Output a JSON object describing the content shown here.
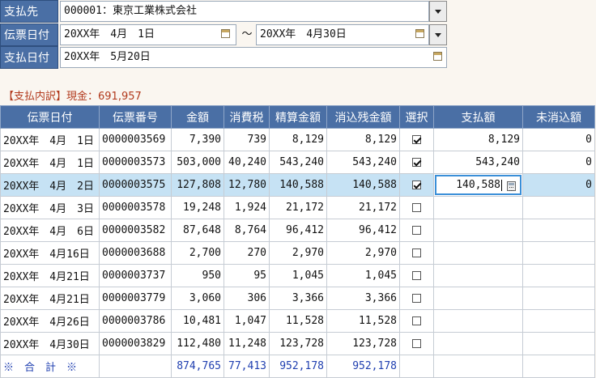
{
  "filters": {
    "payee": {
      "label": "支払先",
      "value": "000001：東京工業株式会社"
    },
    "voucher_date": {
      "label": "伝票日付",
      "from": "20XX年　4月　1日",
      "separator": "～",
      "to": "20XX年　4月30日"
    },
    "payment_date": {
      "label": "支払日付",
      "value": "20XX年　5月20日"
    }
  },
  "summary": "【支払内訳】現金：691,957",
  "table": {
    "headers": [
      "伝票日付",
      "伝票番号",
      "金額",
      "消費税",
      "精算金額",
      "消込残金額",
      "選択",
      "支払額",
      "未消込額"
    ],
    "rows": [
      {
        "date": "20XX年　4月　1日",
        "no": "0000003569",
        "amount": "7,390",
        "tax": "739",
        "settle": "8,129",
        "remain": "8,129",
        "checked": true,
        "pay": "8,129",
        "uncleared": "0"
      },
      {
        "date": "20XX年　4月　1日",
        "no": "0000003573",
        "amount": "503,000",
        "tax": "40,240",
        "settle": "543,240",
        "remain": "543,240",
        "checked": true,
        "pay": "543,240",
        "uncleared": "0"
      },
      {
        "date": "20XX年　4月　2日",
        "no": "0000003575",
        "amount": "127,808",
        "tax": "12,780",
        "settle": "140,588",
        "remain": "140,588",
        "checked": true,
        "pay": "140,588",
        "uncleared": "0"
      },
      {
        "date": "20XX年　4月　3日",
        "no": "0000003578",
        "amount": "19,248",
        "tax": "1,924",
        "settle": "21,172",
        "remain": "21,172",
        "checked": false,
        "pay": "",
        "uncleared": ""
      },
      {
        "date": "20XX年　4月　6日",
        "no": "0000003582",
        "amount": "87,648",
        "tax": "8,764",
        "settle": "96,412",
        "remain": "96,412",
        "checked": false,
        "pay": "",
        "uncleared": ""
      },
      {
        "date": "20XX年　4月16日",
        "no": "0000003688",
        "amount": "2,700",
        "tax": "270",
        "settle": "2,970",
        "remain": "2,970",
        "checked": false,
        "pay": "",
        "uncleared": ""
      },
      {
        "date": "20XX年　4月21日",
        "no": "0000003737",
        "amount": "950",
        "tax": "95",
        "settle": "1,045",
        "remain": "1,045",
        "checked": false,
        "pay": "",
        "uncleared": ""
      },
      {
        "date": "20XX年　4月21日",
        "no": "0000003779",
        "amount": "3,060",
        "tax": "306",
        "settle": "3,366",
        "remain": "3,366",
        "checked": false,
        "pay": "",
        "uncleared": ""
      },
      {
        "date": "20XX年　4月26日",
        "no": "0000003786",
        "amount": "10,481",
        "tax": "1,047",
        "settle": "11,528",
        "remain": "11,528",
        "checked": false,
        "pay": "",
        "uncleared": ""
      },
      {
        "date": "20XX年　4月30日",
        "no": "0000003829",
        "amount": "112,480",
        "tax": "11,248",
        "settle": "123,728",
        "remain": "123,728",
        "checked": false,
        "pay": "",
        "uncleared": ""
      }
    ],
    "total": {
      "label": "※　合　計　※",
      "amount": "874,765",
      "tax": "77,413",
      "settle": "952,178",
      "remain": "952,178"
    },
    "selected_row": 2
  },
  "icons": {
    "calendar": "calendar-icon",
    "dropdown": "chevron-down-icon",
    "calculator": "calculator-icon",
    "checkbox": "checkbox-icon"
  },
  "colors": {
    "header_bg": "#4a6fa5",
    "selected_row_bg": "#c6e2f4",
    "total_text": "#1f3fb0",
    "summary_text": "#b23b1e"
  }
}
